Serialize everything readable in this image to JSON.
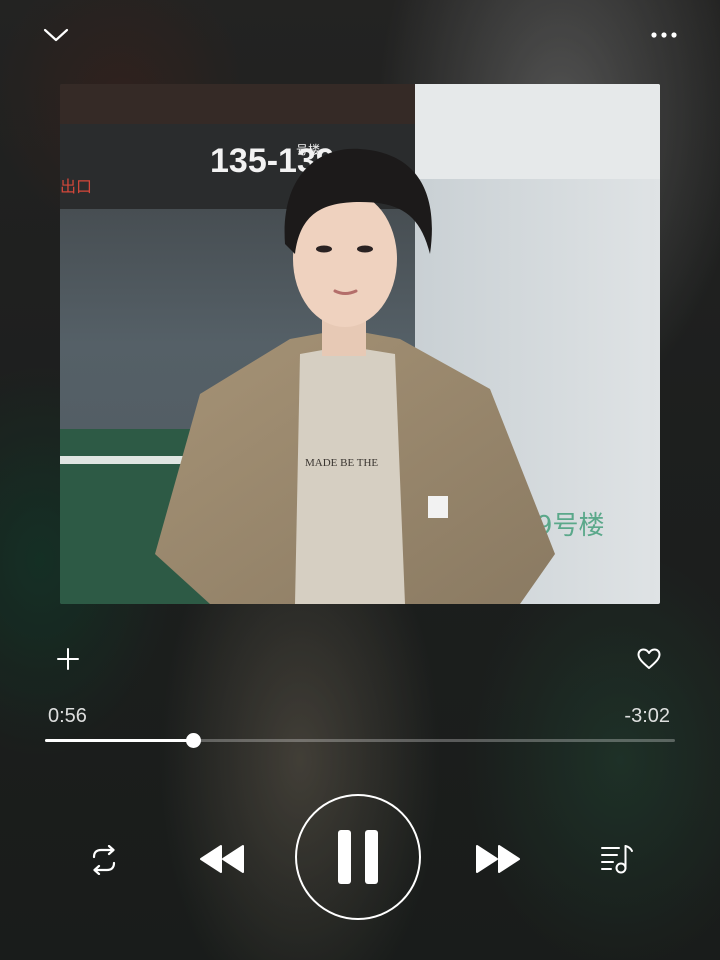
{
  "player": {
    "elapsed": "0:56",
    "remaining": "-3:02",
    "progress_fraction": 0.2357
  },
  "artwork": {
    "sign_text": "135-139",
    "sign_suffix": "号楼",
    "exit_sign": "出口",
    "wall_text": "9号楼",
    "shirt_print": "MADE BE THE"
  },
  "icons": {
    "collapse": "chevron-down-icon",
    "more": "more-dots-icon",
    "add": "plus-icon",
    "like": "heart-icon",
    "repeat": "repeat-icon",
    "previous": "rewind-icon",
    "play_state": "pause-icon",
    "next": "fast-forward-icon",
    "queue": "playlist-icon"
  },
  "colors": {
    "foreground": "#ffffff",
    "track": "#ffffff47"
  }
}
